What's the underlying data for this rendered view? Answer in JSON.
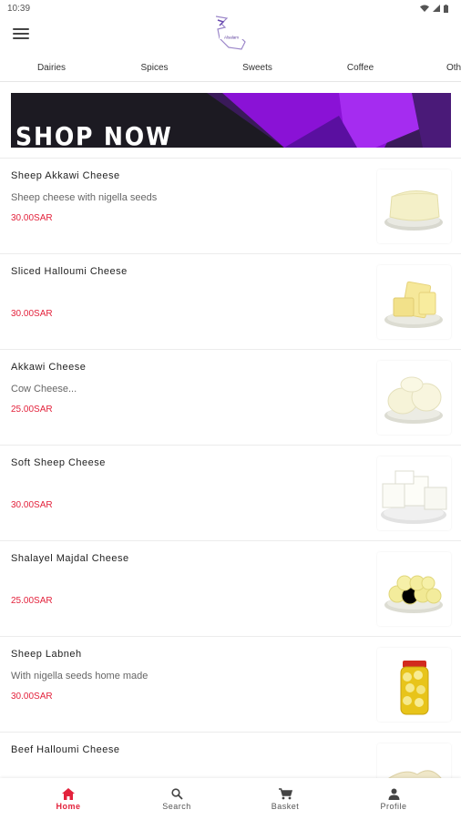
{
  "status_bar": {
    "time": "10:39"
  },
  "app": {
    "logo_text": "Alsalam"
  },
  "tabs": [
    {
      "label": "Dairies",
      "active": true
    },
    {
      "label": "Spices",
      "active": false
    },
    {
      "label": "Sweets",
      "active": false
    },
    {
      "label": "Coffee",
      "active": false
    },
    {
      "label": "Oth",
      "active": false
    }
  ],
  "banner": {
    "text": "SHOP NOW"
  },
  "products": [
    {
      "name": "Sheep Akkawi Cheese",
      "description": "Sheep cheese with nigella seeds",
      "price": "30.00SAR",
      "image": "cheese-block-image"
    },
    {
      "name": "Sliced Halloumi Cheese",
      "description": "",
      "price": "30.00SAR",
      "image": "sliced-cheese-image"
    },
    {
      "name": "Akkawi Cheese",
      "description": "Cow Cheese...",
      "price": "25.00SAR",
      "image": "cheese-pieces-image"
    },
    {
      "name": "Soft Sheep Cheese",
      "description": "",
      "price": "30.00SAR",
      "image": "soft-cheese-image"
    },
    {
      "name": "Shalayel Majdal Cheese",
      "description": "",
      "price": "25.00SAR",
      "image": "cheese-balls-image"
    },
    {
      "name": "Sheep Labneh",
      "description": "With nigella seeds home made",
      "price": "30.00SAR",
      "image": "labneh-jar-image"
    },
    {
      "name": "Beef Halloumi Cheese",
      "description": "",
      "price": "",
      "image": "halloumi-image"
    }
  ],
  "bottom_nav": [
    {
      "label": "Home",
      "icon": "home-icon",
      "active": true
    },
    {
      "label": "Search",
      "icon": "search-icon",
      "active": false
    },
    {
      "label": "Basket",
      "icon": "cart-icon",
      "active": false
    },
    {
      "label": "Profile",
      "icon": "profile-icon",
      "active": false
    }
  ],
  "colors": {
    "accent": "#e3223c",
    "tab_indicator": "#e35b63",
    "banner_purple": "#9b1ee0"
  }
}
